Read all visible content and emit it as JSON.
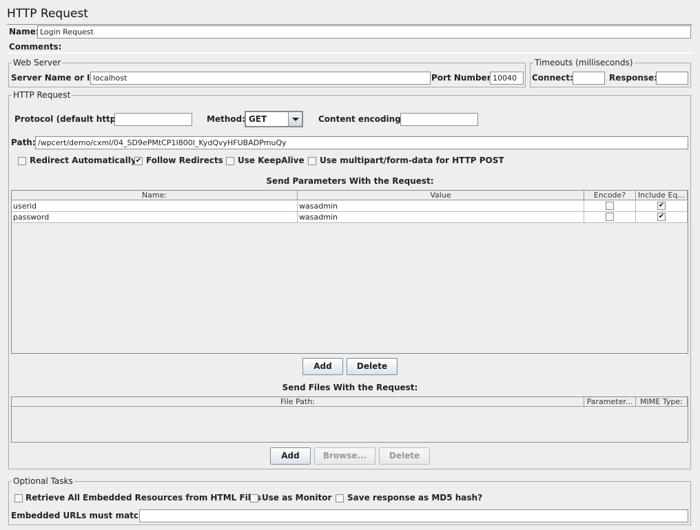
{
  "page": {
    "title": "HTTP Request"
  },
  "name_section": {
    "name_label": "Name:",
    "name_value": "Login Request",
    "comments_label": "Comments:",
    "comments_value": ""
  },
  "web_server": {
    "legend": "Web Server",
    "server_label": "Server Name or IP:",
    "server_value": "localhost",
    "port_label": "Port Number:",
    "port_value": "10040"
  },
  "timeouts": {
    "legend": "Timeouts (milliseconds)",
    "connect_label": "Connect:",
    "connect_value": "",
    "response_label": "Response:",
    "response_value": ""
  },
  "http_request": {
    "legend": "HTTP Request",
    "protocol_label": "Protocol (default http):",
    "protocol_value": "",
    "method_label": "Method:",
    "method_value": "GET",
    "encoding_label": "Content encoding:",
    "encoding_value": "",
    "path_label": "Path:",
    "path_value": "/wpcert/demo/cxml/04_SD9ePMtCP1I800I_KydQvyHFUBADPmuQy",
    "options": [
      {
        "label": "Redirect Automatically",
        "checked": false
      },
      {
        "label": "Follow Redirects",
        "checked": true
      },
      {
        "label": "Use KeepAlive",
        "checked": false
      },
      {
        "label": "Use multipart/form-data for HTTP POST",
        "checked": false
      }
    ]
  },
  "parameters": {
    "heading": "Send Parameters With the Request:",
    "columns": [
      "Name:",
      "Value",
      "Encode?",
      "Include Eq..."
    ],
    "rows": [
      {
        "name": "userid",
        "value": "wasadmin",
        "encode": false,
        "include_equals": true
      },
      {
        "name": "password",
        "value": "wasadmin",
        "encode": false,
        "include_equals": true
      }
    ],
    "add_label": "Add",
    "delete_label": "Delete"
  },
  "files": {
    "heading": "Send Files With the Request:",
    "columns": [
      "File Path:",
      "Parameter...",
      "MIME Type:"
    ],
    "add_label": "Add",
    "browse_label": "Browse...",
    "delete_label": "Delete"
  },
  "optional_tasks": {
    "legend": "Optional Tasks",
    "options": [
      {
        "label": "Retrieve All Embedded Resources from HTML Files",
        "checked": false
      },
      {
        "label": "Use as Monitor",
        "checked": false
      },
      {
        "label": "Save response as MD5 hash?",
        "checked": false
      }
    ],
    "embedded_label": "Embedded URLs must match:",
    "embedded_value": ""
  },
  "check_glyph": "✔"
}
